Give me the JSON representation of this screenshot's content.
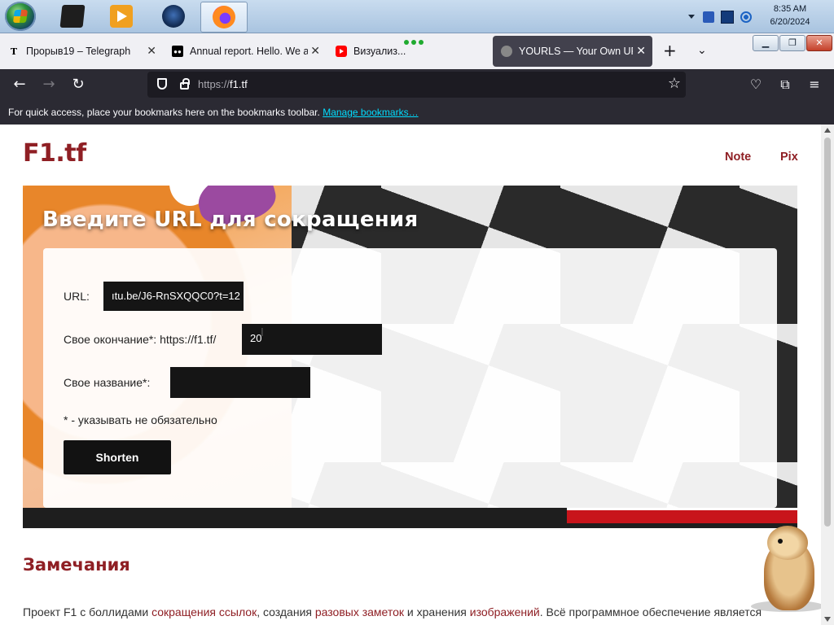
{
  "taskbar": {
    "apps": [
      "start",
      "dark-app",
      "media-player",
      "globe-app",
      "firefox"
    ],
    "clock": {
      "time": "8:35 AM",
      "date": "6/20/2024"
    }
  },
  "browser": {
    "tabs": [
      {
        "title": "Прорыв19 – Telegraph",
        "icon": "telegraph-icon",
        "active": false
      },
      {
        "title": "Annual report. Hello. We ar",
        "icon": "medium-icon",
        "active": false
      },
      {
        "title": "Визуализ...",
        "icon": "youtube-icon",
        "active": false
      },
      {
        "title": "YOURLS — Your Own URL",
        "icon": "yourls-icon",
        "active": true
      }
    ],
    "url_prefix": "https://",
    "url_host": "f1.tf",
    "bookmarks_message": "For quick access, place your bookmarks here on the bookmarks toolbar.",
    "bookmarks_link": "Manage bookmarks…"
  },
  "site": {
    "brand": "F1.tf",
    "nav": [
      "Note",
      "Pix"
    ],
    "hero_title": "Введите URL для сокращения",
    "form": {
      "url_label": "URL:",
      "url_value": "ıtu.be/J6-RnSXQQC0?t=12",
      "keyword_label": "Свое окончание*: https://f1.tf/",
      "keyword_value": "20",
      "title_label": "Свое название*:",
      "title_value": "",
      "note": "* - указывать не обязательно",
      "submit": "Shorten"
    },
    "notes_heading": "Замечания",
    "paragraph": {
      "p1": "Проект F1 с боллидами ",
      "link1": "сокращения ссылок",
      "p2": ", создания ",
      "link2": "разовых заметок",
      "p3": " и хранения ",
      "link3": "изображений",
      "p4": ". Всё программное обеспечение является"
    }
  },
  "colors": {
    "brand": "#8f1f24",
    "field_bg": "#151515",
    "toolbar": "#2b2a33"
  }
}
